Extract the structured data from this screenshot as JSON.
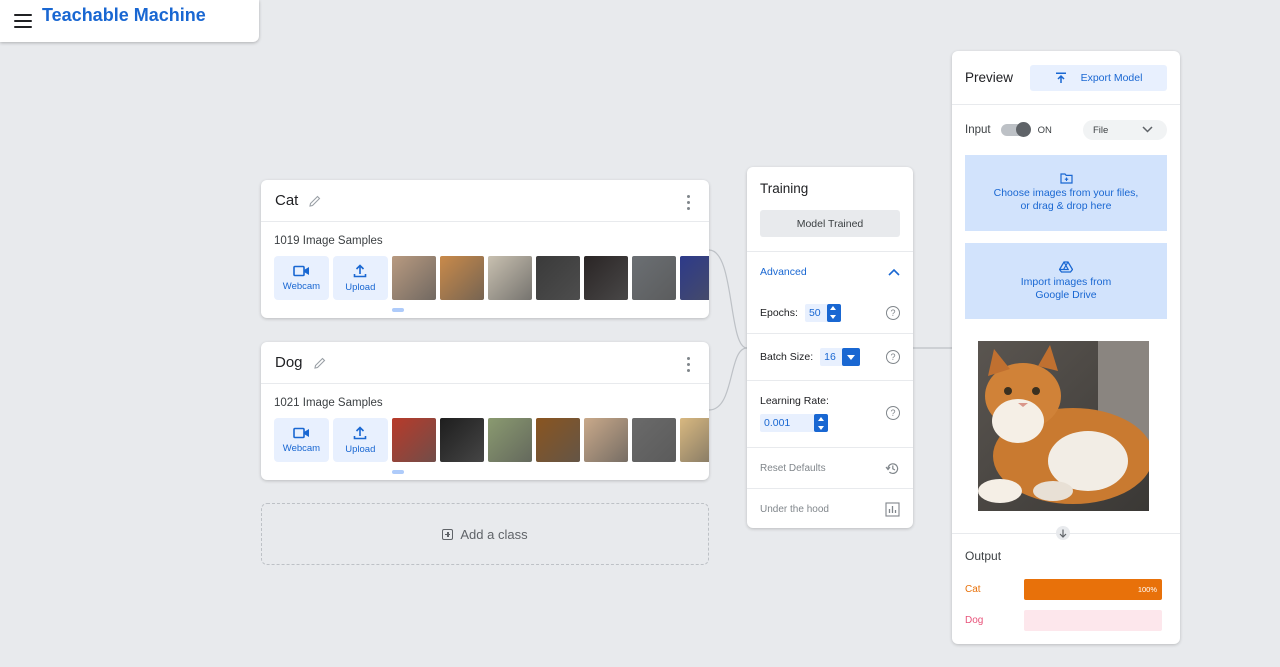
{
  "app": {
    "title": "Teachable Machine"
  },
  "classes": [
    {
      "name": "Cat",
      "sample_count": "1019 Image Samples",
      "webcam_label": "Webcam",
      "upload_label": "Upload",
      "thumb_colors": [
        "#b89a80",
        "#c98a4a",
        "#c8c0b0",
        "#3a3a3a",
        "#2a2525",
        "#6b6f73",
        "#2d3a8a"
      ]
    },
    {
      "name": "Dog",
      "sample_count": "1021 Image Samples",
      "webcam_label": "Webcam",
      "upload_label": "Upload",
      "thumb_colors": [
        "#b83a2a",
        "#1e1e1e",
        "#8a9a70",
        "#8a5520",
        "#c9a98a",
        "#6a6a6a",
        "#d8b880"
      ]
    }
  ],
  "add_class_label": "Add a class",
  "training": {
    "title": "Training",
    "train_button": "Model Trained",
    "advanced_label": "Advanced",
    "epochs_label": "Epochs:",
    "epochs_value": "50",
    "batch_label": "Batch Size:",
    "batch_value": "16",
    "lr_label": "Learning Rate:",
    "lr_value": "0.001",
    "reset_label": "Reset Defaults",
    "hood_label": "Under the hood"
  },
  "preview": {
    "title": "Preview",
    "export_label": "Export Model",
    "input_label": "Input",
    "toggle_state": "ON",
    "source_value": "File",
    "drop_line1": "Choose images from your files,",
    "drop_line2": "or drag & drop here",
    "drive_line1": "Import images from",
    "drive_line2": "Google Drive",
    "output_title": "Output",
    "outputs": [
      {
        "name": "Cat",
        "percent_label": "100%",
        "confidence": 1.0,
        "color": "#e8710a",
        "track": "#fce8d6"
      },
      {
        "name": "Dog",
        "percent_label": "",
        "confidence": 0.0,
        "color": "#e8537a",
        "track": "#fde7ec"
      }
    ]
  },
  "colors": {
    "accent": "#1967d2",
    "accent_light": "#e8f0fe",
    "background": "#e8eaed"
  }
}
